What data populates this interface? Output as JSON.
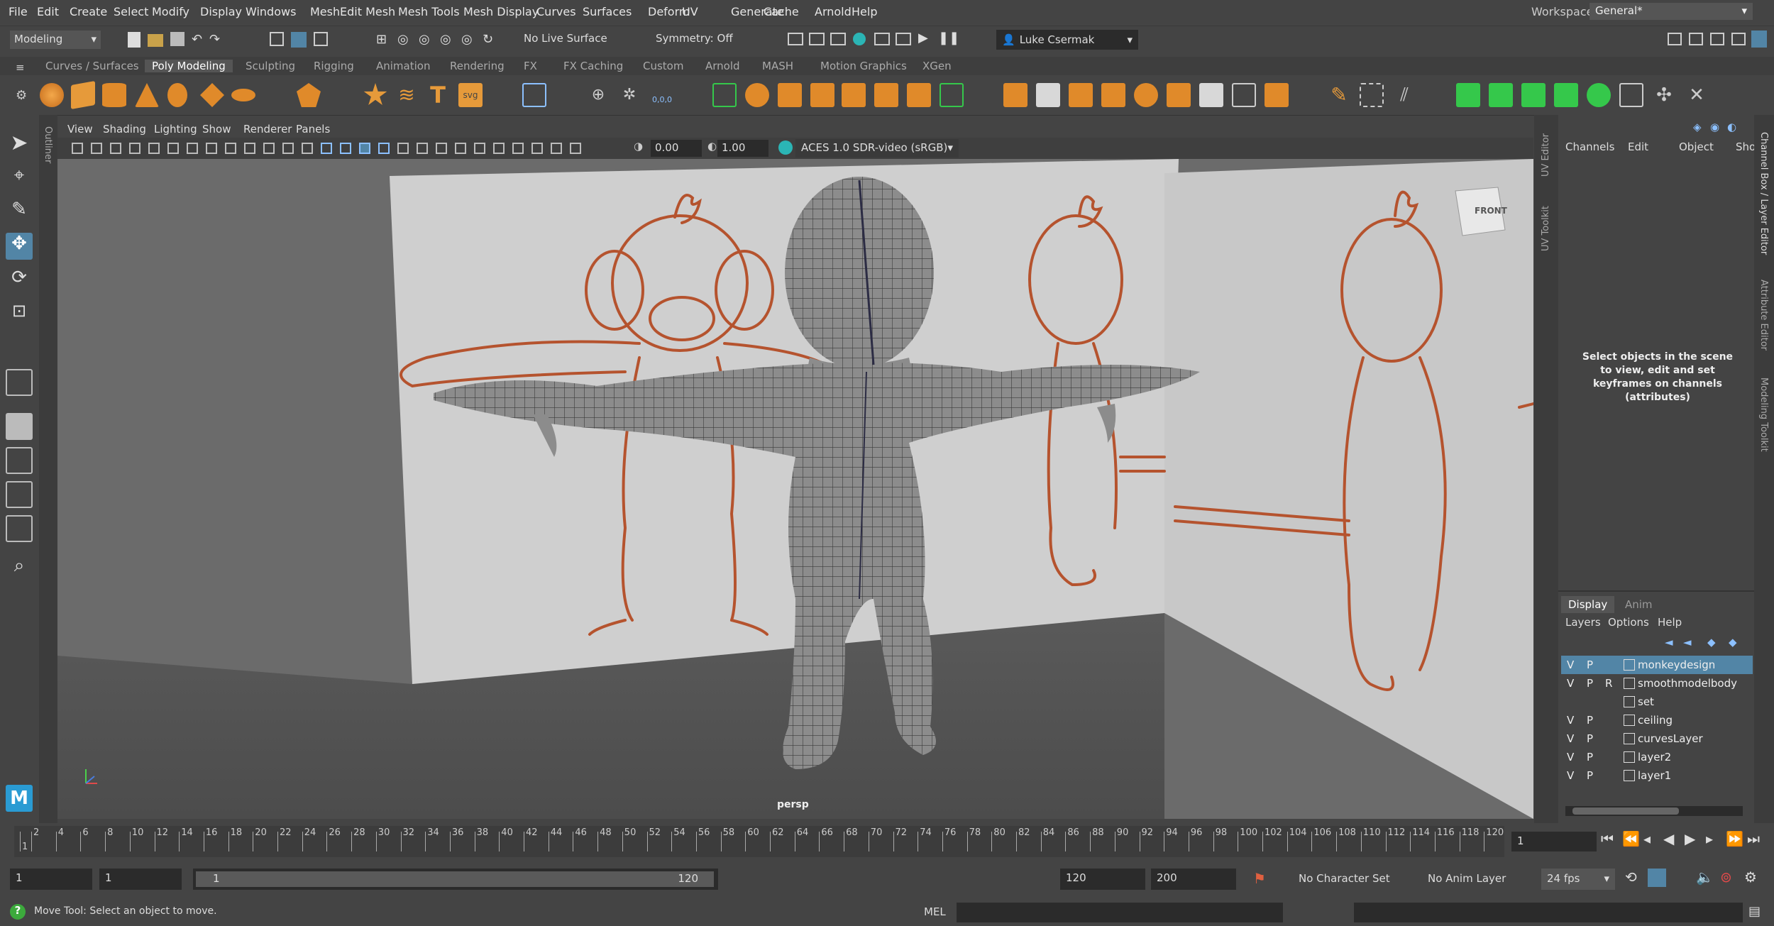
{
  "menu": [
    "File",
    "Edit",
    "Create",
    "Select",
    "Modify",
    "Display",
    "Windows",
    "Mesh",
    "Edit Mesh",
    "Mesh Tools",
    "Mesh Display",
    "Curves",
    "Surfaces",
    "Deform",
    "UV",
    "Generate",
    "Cache",
    "Arnold",
    "Help"
  ],
  "workspace": {
    "label": "Workspace:",
    "value": "General*"
  },
  "status_line": {
    "mode": "Modeling",
    "live_surface": "No Live Surface",
    "symmetry": "Symmetry: Off",
    "user": "Luke Csermak"
  },
  "shelf_tabs": [
    "Curves / Surfaces",
    "Poly Modeling",
    "Sculpting",
    "Rigging",
    "Animation",
    "Rendering",
    "FX",
    "FX Caching",
    "Custom",
    "Arnold",
    "MASH",
    "Motion Graphics",
    "XGen"
  ],
  "active_shelf": "Poly Modeling",
  "viewport_menu": [
    "View",
    "Shading",
    "Lighting",
    "Show",
    "Renderer",
    "Panels"
  ],
  "viewport_bar": {
    "exposure": "0.00",
    "gamma": "1.00",
    "colorspace": "ACES 1.0 SDR-video (sRGB)"
  },
  "viewport": {
    "camera": "persp",
    "viewcube": "FRONT",
    "outliner_label": "Outliner"
  },
  "side_tabs": {
    "uv_editor": "UV Editor",
    "uv_toolkit": "UV Toolkit",
    "channel_box": "Channel Box / Layer Editor",
    "attribute_editor": "Attribute Editor",
    "modeling_toolkit": "Modeling Toolkit"
  },
  "channel_box": {
    "menu": [
      "Channels",
      "Edit",
      "Object",
      "Show"
    ],
    "hint": "Select objects in the scene to view, edit and set keyframes on channels (attributes)"
  },
  "layer_editor": {
    "tabs": [
      "Display",
      "Anim"
    ],
    "menu": [
      "Layers",
      "Options",
      "Help"
    ],
    "layers": [
      {
        "v": "V",
        "p": "P",
        "r": "",
        "name": "monkeydesign",
        "selected": true
      },
      {
        "v": "V",
        "p": "P",
        "r": "R",
        "name": "smoothmodelbody",
        "selected": false
      },
      {
        "v": "",
        "p": "",
        "r": "",
        "name": "set",
        "selected": false
      },
      {
        "v": "V",
        "p": "P",
        "r": "",
        "name": "ceiling",
        "selected": false
      },
      {
        "v": "V",
        "p": "P",
        "r": "",
        "name": "curvesLayer",
        "selected": false
      },
      {
        "v": "V",
        "p": "P",
        "r": "",
        "name": "layer2",
        "selected": false
      },
      {
        "v": "V",
        "p": "P",
        "r": "",
        "name": "layer1",
        "selected": false
      }
    ]
  },
  "timeline": {
    "ticks": [
      "1",
      "2",
      "4",
      "6",
      "8",
      "10",
      "12",
      "14",
      "16",
      "18",
      "20",
      "22",
      "24",
      "26",
      "28",
      "30",
      "32",
      "34",
      "36",
      "38",
      "40",
      "42",
      "44",
      "46",
      "48",
      "50",
      "52",
      "54",
      "56",
      "58",
      "60",
      "62",
      "64",
      "66",
      "68",
      "70",
      "72",
      "74",
      "76",
      "78",
      "80",
      "82",
      "84",
      "86",
      "88",
      "90",
      "92",
      "94",
      "96",
      "98",
      "100",
      "102",
      "104",
      "106",
      "108",
      "110",
      "112",
      "114",
      "116",
      "118",
      "120"
    ],
    "current_frame": "1"
  },
  "range": {
    "start": "1",
    "playback_start": "1",
    "slider_start": "1",
    "slider_end": "120",
    "playback_end": "120",
    "end": "200",
    "character_set": "No Character Set",
    "anim_layer": "No Anim Layer",
    "fps": "24 fps"
  },
  "help_line": {
    "message": "Move Tool: Select an object to move.",
    "mel": "MEL"
  },
  "colors": {
    "accent": "#5285a6",
    "sketch": "#b5532e",
    "panel": "#444444",
    "mesh": "#8c8c8c"
  }
}
